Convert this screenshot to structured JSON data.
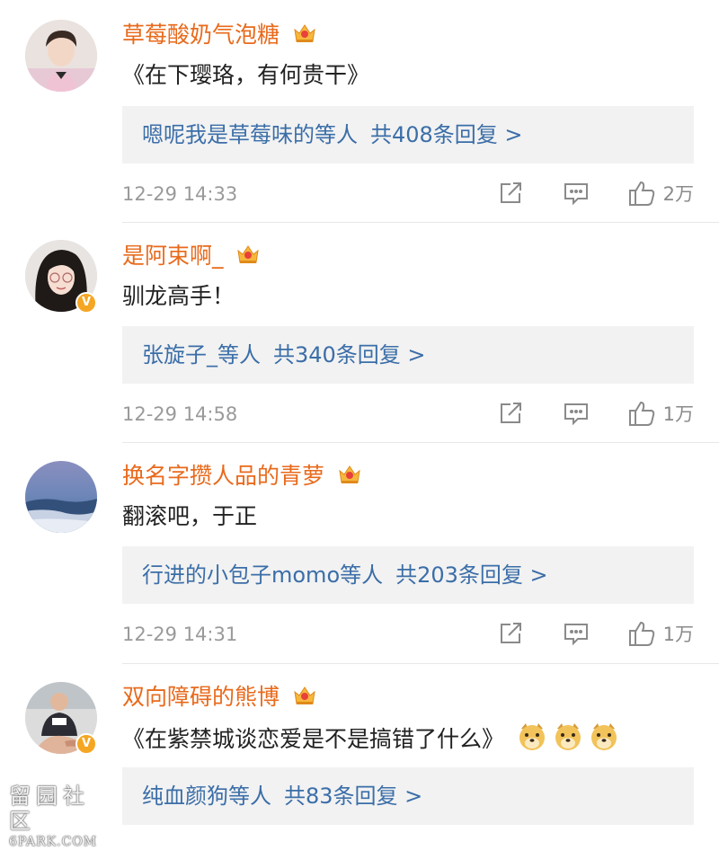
{
  "comments": [
    {
      "username": "草莓酸奶气泡糖",
      "text": "《在下璎珞，有何贵干》",
      "reply_who": "嗯呢我是草莓味的",
      "reply_etc": "等人",
      "reply_count": "共408条回复 >",
      "time": "12-29 14:33",
      "likes": "2万",
      "verified": false,
      "avatar": "young-man-avatar"
    },
    {
      "username": "是阿束啊_",
      "text": "驯龙高手！",
      "reply_who": "张旋子_",
      "reply_etc": "等人",
      "reply_count": "共340条回复 >",
      "time": "12-29 14:58",
      "likes": "1万",
      "verified": true,
      "avatar": "young-woman-avatar"
    },
    {
      "username": "换名字攒人品的青萝",
      "text": "翻滚吧，于正",
      "reply_who": "行进的小包子momo",
      "reply_etc": "等人",
      "reply_count": "共203条回复 >",
      "time": "12-29 14:31",
      "likes": "1万",
      "verified": false,
      "avatar": "landscape-avatar"
    },
    {
      "username": "双向障碍的熊博",
      "text": "《在紫禁城谈恋爱是不是搞错了什么》",
      "reply_who": "纯血颜狗",
      "reply_etc": "等人",
      "reply_count": "共83条回复 >",
      "verified": true,
      "avatar": "man-sitting-avatar",
      "emoji": "doge-emoji"
    }
  ],
  "watermark": {
    "line1": "留园社区",
    "line2": "6PARK.COM"
  },
  "colors": {
    "username": "#e86a1c",
    "reply_link": "#3b6ea8",
    "meta": "#9a9a9a",
    "verified_badge": "#f5a623"
  }
}
